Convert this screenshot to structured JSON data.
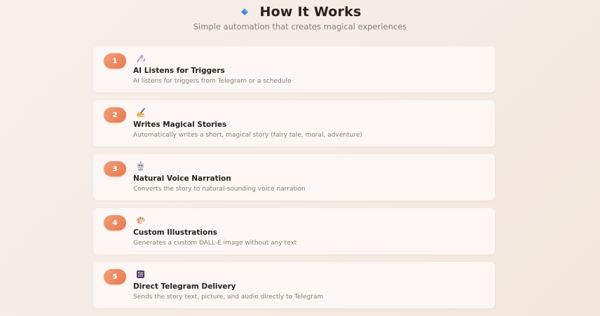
{
  "header": {
    "icon": "blue-diamond-icon",
    "title": "How It Works",
    "subtitle": "Simple automation that creates magical experiences"
  },
  "colors": {
    "accent": "#e5784f",
    "diamond": "#4a86d8",
    "card_bg": "#fcf7f4",
    "title_text": "#2b2220",
    "muted_text": "#8a7d77"
  },
  "steps": [
    {
      "number": "1",
      "icon": "microphone-music-icon",
      "title": "AI Listens for Triggers",
      "description": "AI listens for triggers from Telegram or a schedule"
    },
    {
      "number": "2",
      "icon": "writing-hand-icon",
      "title": "Writes Magical Stories",
      "description": "Automatically writes a short, magical story (fairy tale, moral, adventure)"
    },
    {
      "number": "3",
      "icon": "robot-icon",
      "title": "Natural Voice Narration",
      "description": "Converts the story to natural-sounding voice narration"
    },
    {
      "number": "4",
      "icon": "artist-palette-icon",
      "title": "Custom Illustrations",
      "description": "Generates a custom DALL-E image without any text"
    },
    {
      "number": "5",
      "icon": "grid-app-icon",
      "title": "Direct Telegram Delivery",
      "description": "Sends the story text, picture, and audio directly to Telegram"
    }
  ]
}
